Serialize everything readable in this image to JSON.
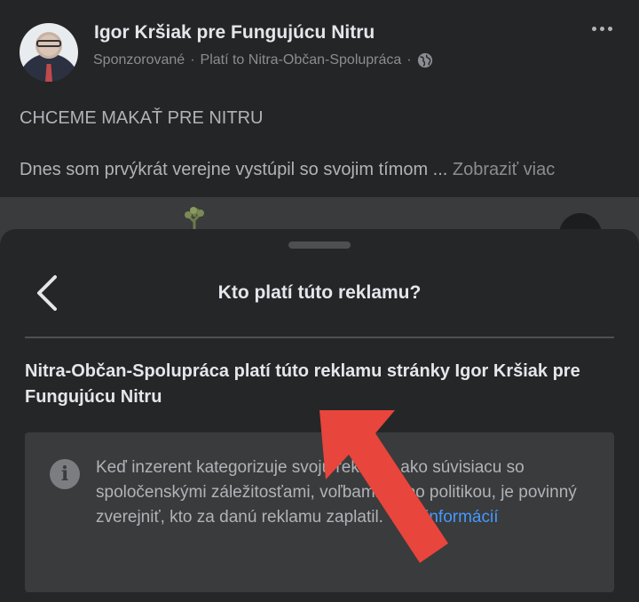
{
  "post": {
    "author": "Igor Kršiak pre Fungujúcu Nitru",
    "sponsored": "Sponzorované",
    "separator": "·",
    "paid_by": "Platí to Nitra-Občan-Spolupráca",
    "separator2": "·",
    "headline": "CHCEME MAKAŤ PRE NITRU",
    "body": "Dnes som prvýkrát verejne vystúpil so svojim tímom ...",
    "see_more": "Zobraziť viac"
  },
  "sheet": {
    "title": "Kto platí túto reklamu?",
    "statement": "Nitra-Občan-Spolupráca platí túto reklamu stránky Igor Kršiak pre Fungujúcu Nitru",
    "info_text": "Keď inzerent kategorizuje svoju reklamu ako súvisiacu so spoločenskými záležitosťami, voľbami alebo politikou, je povinný zverejniť, kto za danú reklamu zaplatil.",
    "info_link": "Viac informácií",
    "info_icon_glyph": "i"
  },
  "colors": {
    "background": "#18191a",
    "post_bg": "#242526",
    "sheet_bg": "#252627",
    "info_box_bg": "#3a3b3c",
    "link": "#4599ff",
    "arrow": "#e8453c"
  },
  "icons": [
    "globe-icon",
    "more-options-icon",
    "back-chevron-icon",
    "info-icon",
    "annotation-arrow"
  ]
}
